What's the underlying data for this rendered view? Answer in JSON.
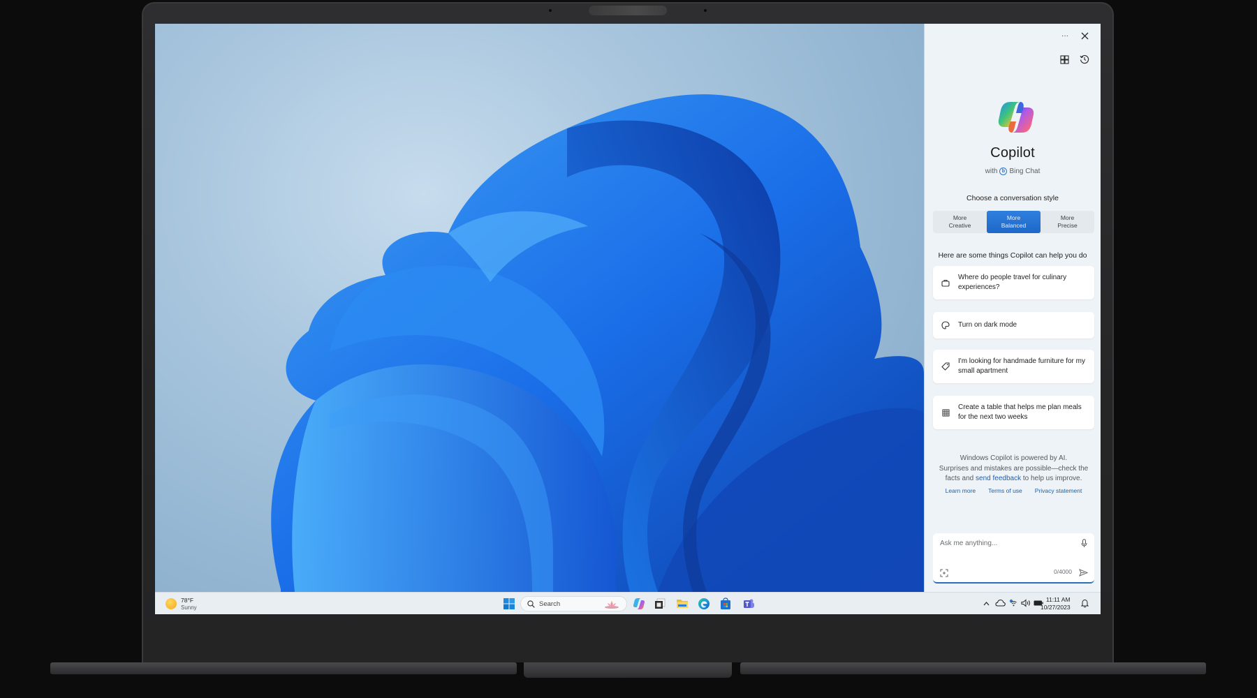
{
  "copilot": {
    "more_menu_label": "···",
    "title": "Copilot",
    "subtitle_prefix": "with",
    "subtitle_brand": "Bing Chat",
    "choose_style_label": "Choose a conversation style",
    "styles": [
      {
        "line1": "More",
        "line2": "Creative",
        "active": false
      },
      {
        "line1": "More",
        "line2": "Balanced",
        "active": true
      },
      {
        "line1": "More",
        "line2": "Precise",
        "active": false
      }
    ],
    "help_heading": "Here are some things Copilot can help you do",
    "suggestions": [
      {
        "icon": "briefcase-icon",
        "text": "Where do people travel for culinary experiences?"
      },
      {
        "icon": "palette-icon",
        "text": "Turn on dark mode"
      },
      {
        "icon": "tag-icon",
        "text": "I'm looking for handmade furniture for my small apartment"
      },
      {
        "icon": "table-icon",
        "text": "Create a table that helps me plan meals for the next two weeks"
      }
    ],
    "disclaimer": {
      "line1": "Windows Copilot is powered by AI.",
      "line2": "Surprises and mistakes are possible—check the facts and",
      "link": "send feedback",
      "line3": "to help us improve."
    },
    "links": [
      "Learn more",
      "Terms of use",
      "Privacy statement"
    ],
    "composer": {
      "placeholder": "Ask me anything...",
      "char_count": "0/4000"
    },
    "accent_color": "#1d68c9"
  },
  "taskbar": {
    "weather": {
      "temp": "78°F",
      "condition": "Sunny"
    },
    "search_label": "Search",
    "apps": [
      "start",
      "copilot",
      "task-view",
      "file-explorer",
      "edge",
      "store",
      "teams"
    ],
    "clock": {
      "time": "11:11 AM",
      "date": "10/27/2023"
    }
  }
}
